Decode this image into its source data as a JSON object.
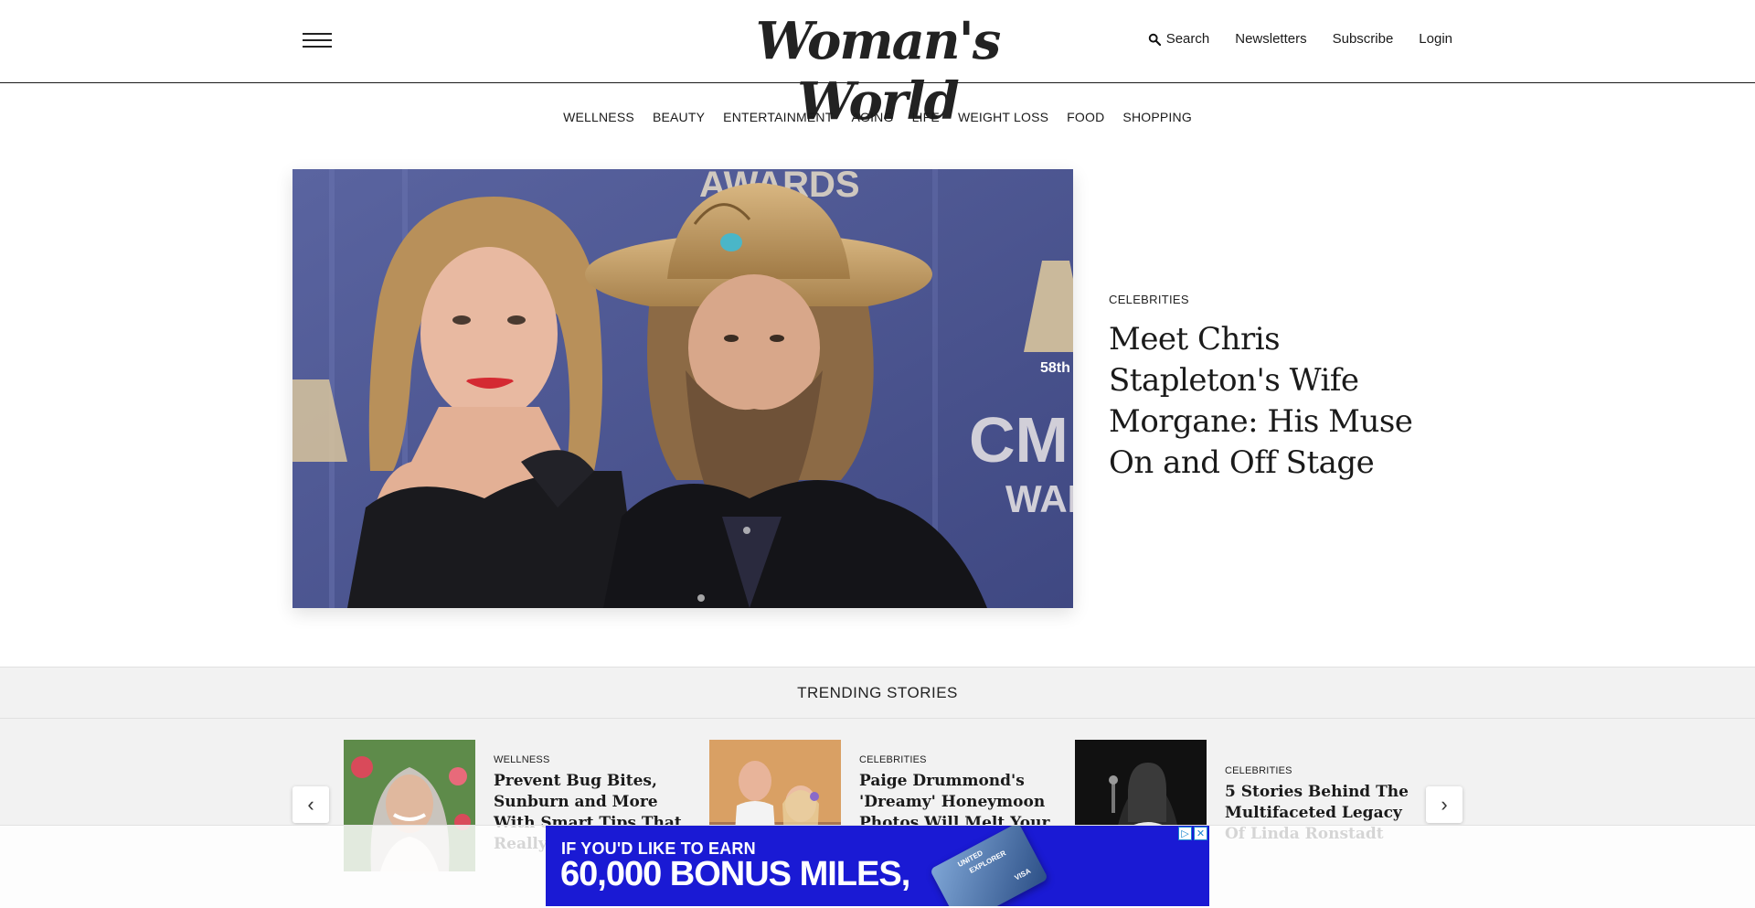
{
  "header": {
    "logo": "Woman's World",
    "search_label": "Search",
    "newsletters_label": "Newsletters",
    "subscribe_label": "Subscribe",
    "login_label": "Login"
  },
  "nav": {
    "items": [
      "WELLNESS",
      "BEAUTY",
      "ENTERTAINMENT",
      "AGING",
      "LIFE",
      "WEIGHT LOSS",
      "FOOD",
      "SHOPPING"
    ]
  },
  "hero": {
    "category": "CELEBRITIES",
    "title": "Meet Chris Stapleton's Wife Morgane: His Muse On and Off Stage",
    "image_text": {
      "awards": "AWARDS",
      "cma": "CM",
      "war": "WAR",
      "edition": "58th"
    }
  },
  "trending": {
    "heading": "TRENDING STORIES",
    "cards": [
      {
        "category": "WELLNESS",
        "title": "Prevent Bug Bites, Sunburn and More With Smart Tips That Really Work"
      },
      {
        "category": "CELEBRITIES",
        "title": "Paige Drummond's 'Dreamy' Honeymoon Photos Will Melt Your"
      },
      {
        "category": "CELEBRITIES",
        "title": "5 Stories Behind The Multifaceted Legacy Of Linda Ronstadt"
      }
    ]
  },
  "ad": {
    "line1": "IF YOU'D LIKE TO EARN",
    "line2": "60,000 BONUS MILES,",
    "card_brand": "UNITED",
    "card_name": "EXPLORER",
    "card_network": "VISA",
    "colors": {
      "background": "#1a1ad4",
      "text": "#ffffff"
    }
  },
  "colors": {
    "trending_bg": "#f2f2f2",
    "text": "#1a1a1a"
  }
}
